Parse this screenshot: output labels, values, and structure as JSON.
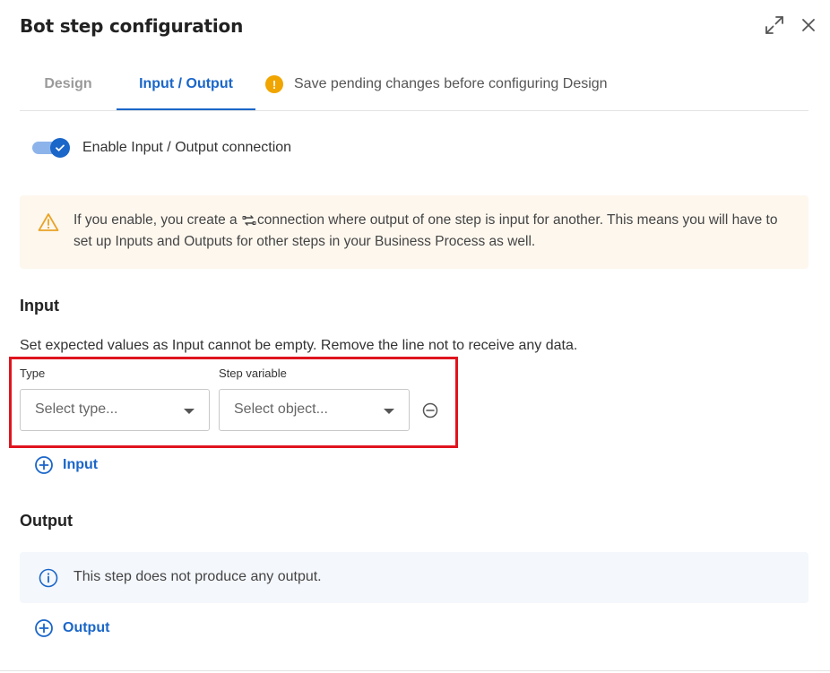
{
  "dialog": {
    "title": "Bot step configuration"
  },
  "tabs": [
    {
      "label": "Design",
      "active": false
    },
    {
      "label": "Input / Output",
      "active": true
    }
  ],
  "pending_notice": {
    "icon": "exclamation-icon",
    "text": "Save pending changes before configuring Design"
  },
  "toggle": {
    "label": "Enable Input / Output connection",
    "enabled": true
  },
  "alert": {
    "icon": "warning-triangle-icon",
    "text_before": "If you enable, you create a ",
    "text_after": "connection where output of one step is input for another. This means you will have to set up Inputs and Outputs for other steps in your Business Process as well."
  },
  "input_section": {
    "heading": "Input",
    "description": "Set expected values as Input cannot be empty. Remove the line not to receive any data.",
    "type_label": "Type",
    "type_placeholder": "Select type...",
    "variable_label": "Step variable",
    "variable_placeholder": "Select object...",
    "add_label": "Input"
  },
  "output_section": {
    "heading": "Output",
    "info_text": "This step does not produce any output.",
    "add_label": "Output"
  },
  "colors": {
    "accent": "#1a66c9",
    "warning": "#f0a500",
    "highlight": "#e0141e",
    "alert_bg": "#fdf7ee",
    "info_bg": "#f4f7fc"
  }
}
